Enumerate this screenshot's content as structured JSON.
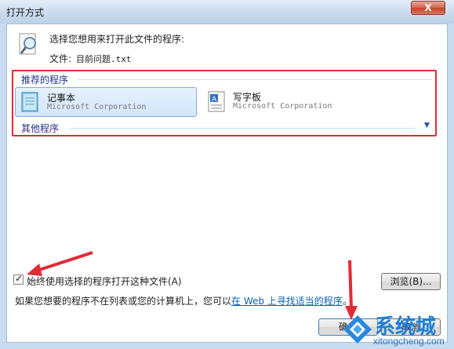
{
  "window": {
    "title": "打开方式",
    "close_label": "X"
  },
  "header": {
    "prompt": "选择您想用来打开此文件的程序:",
    "file_label": "文件:",
    "file_name": "目前问题.txt"
  },
  "programs": {
    "recommended_heading": "推荐的程序",
    "items": [
      {
        "name": "记事本",
        "publisher": "Microsoft Corporation",
        "icon": "notepad-icon",
        "selected": true
      },
      {
        "name": "写字板",
        "publisher": "Microsoft Corporation",
        "icon": "wordpad-icon",
        "selected": false
      }
    ],
    "other_heading": "其他程序"
  },
  "options": {
    "always_use_label": "始终使用选择的程序打开这种文件(A)",
    "always_use_checked": true,
    "browse_label": "浏览(B)...",
    "hint_text": "如果您想要的程序不在列表或您的计算机上，您可以",
    "hint_link": "在 Web 上寻找适当的程序",
    "hint_end": "。"
  },
  "buttons": {
    "ok_label": "确定",
    "cancel_label": "取消"
  },
  "watermark": {
    "text": "系统城",
    "url_text": "xitongcheng.com"
  },
  "colors": {
    "highlight_border": "#e02b36",
    "link": "#0e5fb3",
    "selection": "#d3e6fa",
    "accent": "#1d7fd6"
  }
}
